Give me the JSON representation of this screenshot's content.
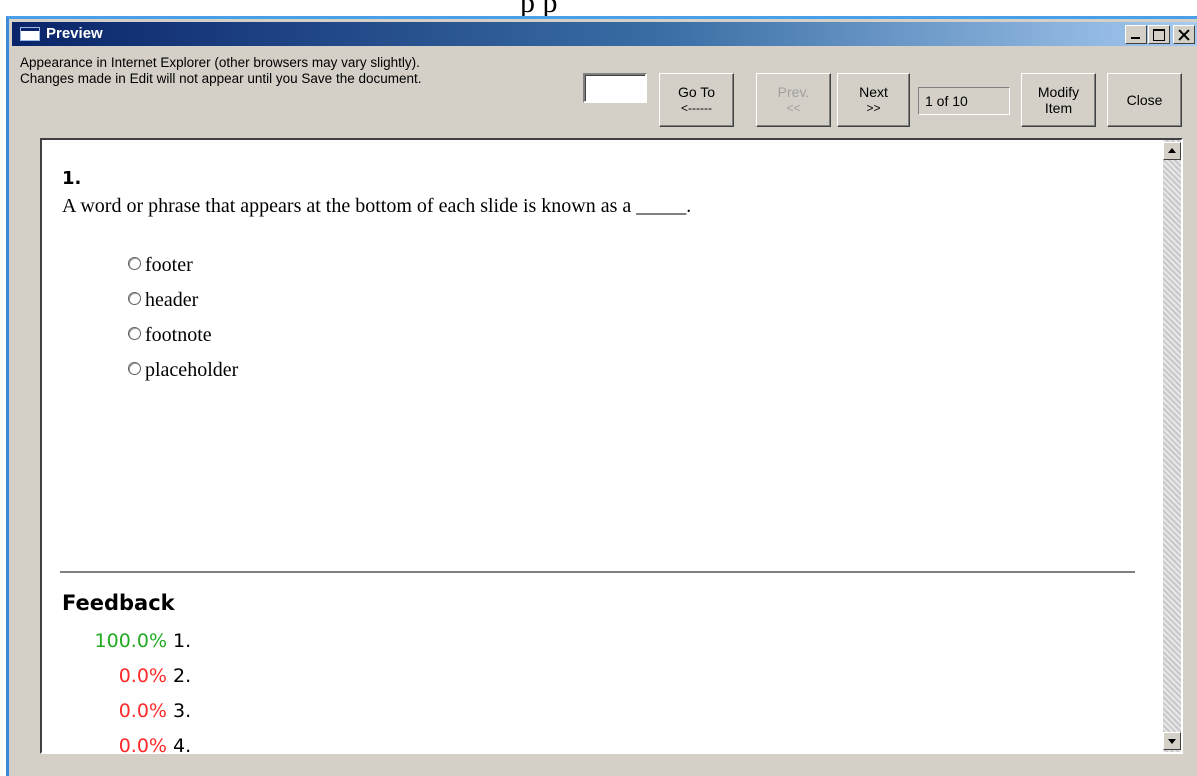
{
  "window": {
    "title": "Preview"
  },
  "toolbar": {
    "info_line1": "Appearance in Internet Explorer (other browsers may vary slightly).",
    "info_line2": "Changes made in Edit will not appear until you Save the document.",
    "goto_value": "",
    "goto_label1": "Go To",
    "goto_label2": "<------",
    "prev_label1": "Prev.",
    "prev_label2": "<<",
    "next_label1": "Next",
    "next_label2": ">>",
    "page_indicator": "1 of 10",
    "modify_label1": "Modify",
    "modify_label2": "Item",
    "close_label": "Close"
  },
  "question": {
    "number": "1.",
    "text": "A word or phrase that appears at the bottom of each slide is known as a _____.",
    "options": [
      "footer",
      "header",
      "footnote",
      "placeholder"
    ]
  },
  "feedback": {
    "title": "Feedback",
    "rows": [
      {
        "percent": "100.0%",
        "label": "1.",
        "color": "#22aa22"
      },
      {
        "percent": "0.0%",
        "label": "2.",
        "color": "#ff2a2a"
      },
      {
        "percent": "0.0%",
        "label": "3.",
        "color": "#ff2a2a"
      },
      {
        "percent": "0.0%",
        "label": "4.",
        "color": "#ff2a2a"
      }
    ]
  },
  "colors": {
    "titlebar_start": "#0a246a",
    "titlebar_end": "#a6caf0",
    "window_bg": "#d4d0c8"
  }
}
